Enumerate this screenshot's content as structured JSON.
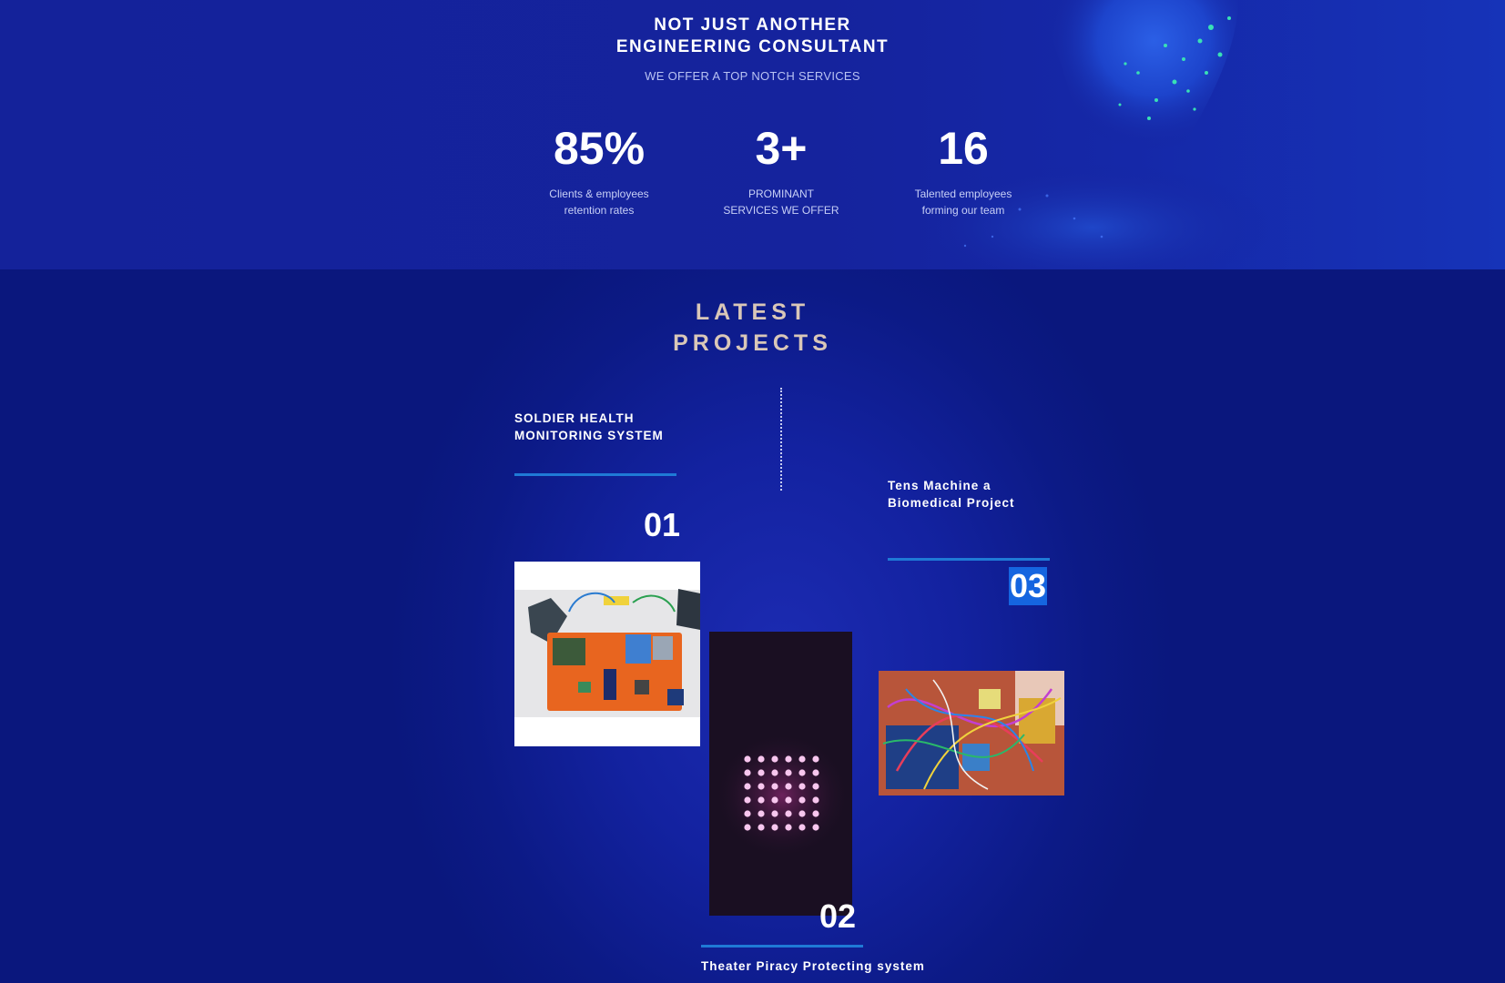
{
  "stats_section": {
    "headline_line1": "NOT JUST ANOTHER",
    "headline_line2": "ENGINEERING CONSULTANT",
    "subheadline": "WE OFFER A TOP NOTCH SERVICES",
    "stats": [
      {
        "value": "85%",
        "label_line1": "Clients & employees",
        "label_line2": "retention rates"
      },
      {
        "value": "3+",
        "label_line1": "PROMINANT",
        "label_line2": "SERVICES WE OFFER"
      },
      {
        "value": "16",
        "label_line1": "Talented employees",
        "label_line2": "forming our team"
      }
    ]
  },
  "projects_section": {
    "title_line1": "LATEST",
    "title_line2": "PROJECTS",
    "projects": [
      {
        "number": "01",
        "title_line1": "SOLDIER HEALTH",
        "title_line2": "MONITORING SYSTEM"
      },
      {
        "number": "02",
        "title_line1": "Theater Piracy Protecting system",
        "title_line2": ""
      },
      {
        "number": "03",
        "title_line1": "Tens Machine a",
        "title_line2": "Biomedical Project"
      }
    ]
  },
  "colors": {
    "accent_line": "#1f7ad6",
    "section_title": "#d9c7b8",
    "highlight": "#1565e0"
  }
}
